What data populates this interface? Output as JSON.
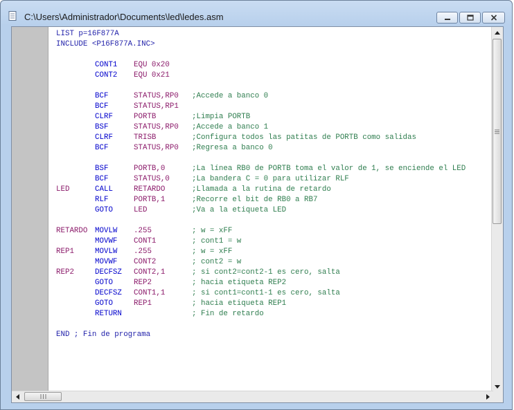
{
  "window": {
    "title": "C:\\Users\\Administrador\\Documents\\led\\ledes.asm",
    "title_bar_color": "#b8d0ec"
  },
  "icons": {
    "app": "document-icon",
    "minimize": "minimize-icon",
    "maximize": "maximize-icon",
    "close": "close-icon",
    "scroll_thumb_grip": "grip-icon"
  },
  "editor": {
    "lines": [
      [
        "LIST p=16F877A",
        "",
        "",
        ""
      ],
      [
        "INCLUDE <P16F877A.INC>",
        "",
        "",
        ""
      ],
      [
        "",
        "",
        "",
        ""
      ],
      [
        "",
        "CONT1",
        "EQU 0x20",
        ""
      ],
      [
        "",
        "CONT2",
        "EQU 0x21",
        ""
      ],
      [
        "",
        "",
        "",
        ""
      ],
      [
        "",
        "BCF",
        "STATUS,RP0",
        ";Accede a banco 0"
      ],
      [
        "",
        "BCF",
        "STATUS,RP1",
        ""
      ],
      [
        "",
        "CLRF",
        "PORTB",
        ";Limpia PORTB"
      ],
      [
        "",
        "BSF",
        "STATUS,RP0",
        ";Accede a banco 1"
      ],
      [
        "",
        "CLRF",
        "TRISB",
        ";Configura todos las patitas de PORTB como salidas"
      ],
      [
        "",
        "BCF",
        "STATUS,RP0",
        ";Regresa a banco 0"
      ],
      [
        "",
        "",
        "",
        ""
      ],
      [
        "",
        "BSF",
        "PORTB,0",
        ";La línea RB0 de PORTB toma el valor de 1, se enciende el LED"
      ],
      [
        "",
        "BCF",
        "STATUS,0",
        ";La bandera C = 0 para utilizar RLF"
      ],
      [
        "LED",
        "CALL",
        "RETARDO",
        ";Llamada a la rutina de retardo"
      ],
      [
        "",
        "RLF",
        "PORTB,1",
        ";Recorre el bit de RB0 a RB7"
      ],
      [
        "",
        "GOTO",
        "LED",
        ";Va a la etiqueta LED"
      ],
      [
        "",
        "",
        "",
        ""
      ],
      [
        "RETARDO",
        "MOVLW",
        ".255",
        "; w = xFF"
      ],
      [
        "",
        "MOVWF",
        "CONT1",
        "; cont1 = w"
      ],
      [
        "REP1",
        "MOVLW",
        ".255",
        "; w = xFF"
      ],
      [
        "",
        "MOVWF",
        "CONT2",
        "; cont2 = w"
      ],
      [
        "REP2",
        "DECFSZ",
        "CONT2,1",
        "; si cont2=cont2-1 es cero, salta"
      ],
      [
        "",
        "GOTO",
        "REP2",
        "; hacia etiqueta REP2"
      ],
      [
        "",
        "DECFSZ",
        "CONT1,1",
        "; si cont1=cont1-1 es cero, salta"
      ],
      [
        "",
        "GOTO",
        "REP1",
        "; hacia etiqueta REP1"
      ],
      [
        "",
        "RETURN",
        "",
        "; Fin de retardo"
      ],
      [
        "",
        "",
        "",
        ""
      ],
      [
        "END ; Fin de programa",
        "",
        "",
        ""
      ]
    ]
  }
}
